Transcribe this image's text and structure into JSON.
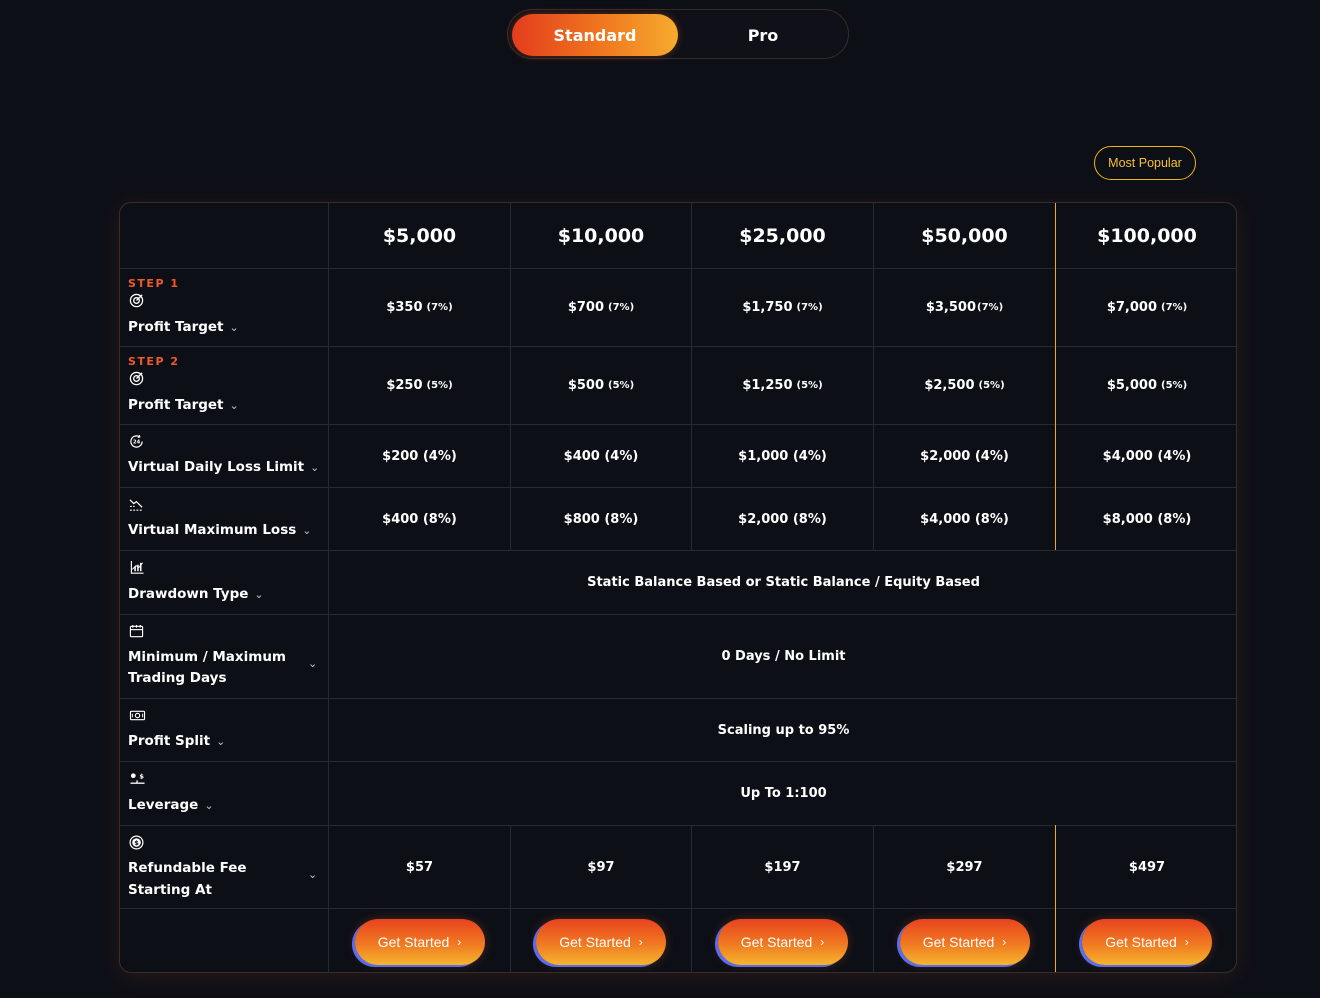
{
  "toggle": {
    "standard": "Standard",
    "pro": "Pro"
  },
  "badge": "Most Popular",
  "columns": [
    "$5,000",
    "$10,000",
    "$25,000",
    "$50,000",
    "$100,000"
  ],
  "rows": {
    "step1": {
      "step": "STEP 1",
      "label": "Profit Target",
      "icon": "target-icon",
      "values": [
        {
          "amt": "$350",
          "pct": "(7%)"
        },
        {
          "amt": "$700",
          "pct": "(7%)"
        },
        {
          "amt": "$1,750",
          "pct": "(7%)"
        },
        {
          "amt": "$3,500",
          "pct": "(7%)"
        },
        {
          "amt": "$7,000",
          "pct": "(7%)"
        }
      ]
    },
    "step2": {
      "step": "STEP 2",
      "label": "Profit Target",
      "icon": "target-icon",
      "values": [
        {
          "amt": "$250",
          "pct": "(5%)"
        },
        {
          "amt": "$500",
          "pct": "(5%)"
        },
        {
          "amt": "$1,250",
          "pct": "(5%)"
        },
        {
          "amt": "$2,500",
          "pct": "(5%)"
        },
        {
          "amt": "$5,000",
          "pct": "(5%)"
        }
      ]
    },
    "daily_loss": {
      "label": "Virtual Daily Loss Limit",
      "icon": "clock-24-icon",
      "values": [
        "$200 (4%)",
        "$400 (4%)",
        "$1,000 (4%)",
        "$2,000 (4%)",
        "$4,000 (4%)"
      ]
    },
    "max_loss": {
      "label": "Virtual Maximum Loss",
      "icon": "chart-down-icon",
      "values": [
        "$400 (8%)",
        "$800 (8%)",
        "$2,000 (8%)",
        "$4,000 (8%)",
        "$8,000 (8%)"
      ]
    },
    "drawdown": {
      "label": "Drawdown Type",
      "icon": "chart-bar-icon",
      "value": "Static Balance Based or Static Balance / Equity Based"
    },
    "trading_days": {
      "label": "Minimum / Maximum Trading Days",
      "icon": "calendar-icon",
      "value": "0 Days / No Limit"
    },
    "profit_split": {
      "label": "Profit Split",
      "icon": "money-icon",
      "value": "Scaling up to 95%"
    },
    "leverage": {
      "label": "Leverage",
      "icon": "leverage-icon",
      "value": "Up To 1:100"
    },
    "fee": {
      "label": "Refundable Fee Starting At",
      "icon": "dollar-coin-icon",
      "values": [
        "$57",
        "$97",
        "$197",
        "$297",
        "$497"
      ]
    }
  },
  "cta": {
    "label": "Get Started",
    "arrow": "›"
  },
  "colors": {
    "accent_orange": "#f07a22",
    "accent_red": "#e33d1d",
    "accent_gold": "#f2b21e",
    "background": "#0d0f17"
  }
}
